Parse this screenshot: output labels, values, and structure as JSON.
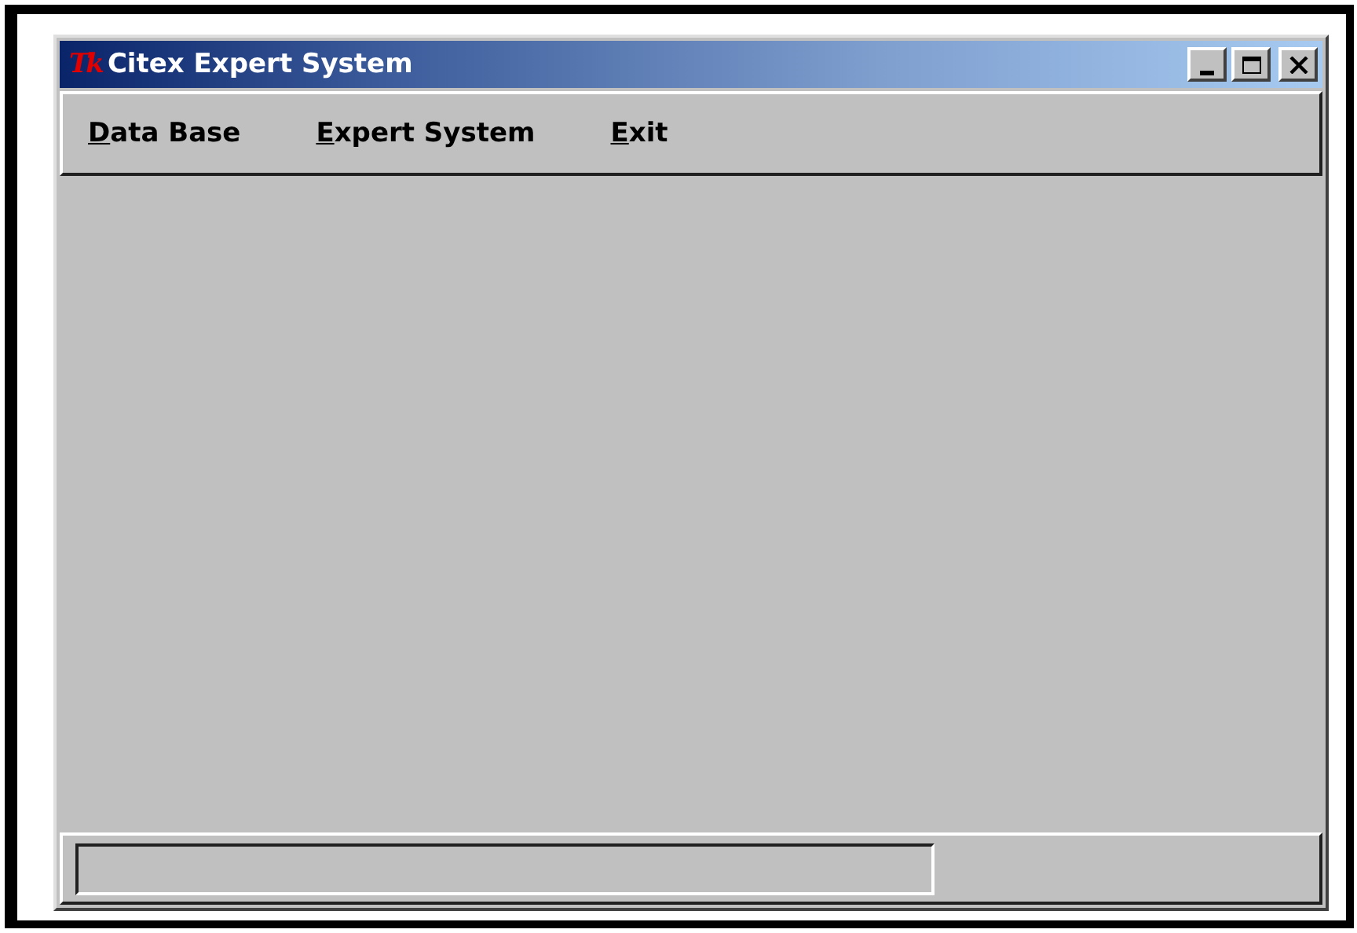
{
  "window": {
    "logo": "Tk",
    "title": "Citex Expert System"
  },
  "menu": [
    {
      "label": "Data Base"
    },
    {
      "label": "Expert System"
    },
    {
      "label": "Exit"
    }
  ]
}
